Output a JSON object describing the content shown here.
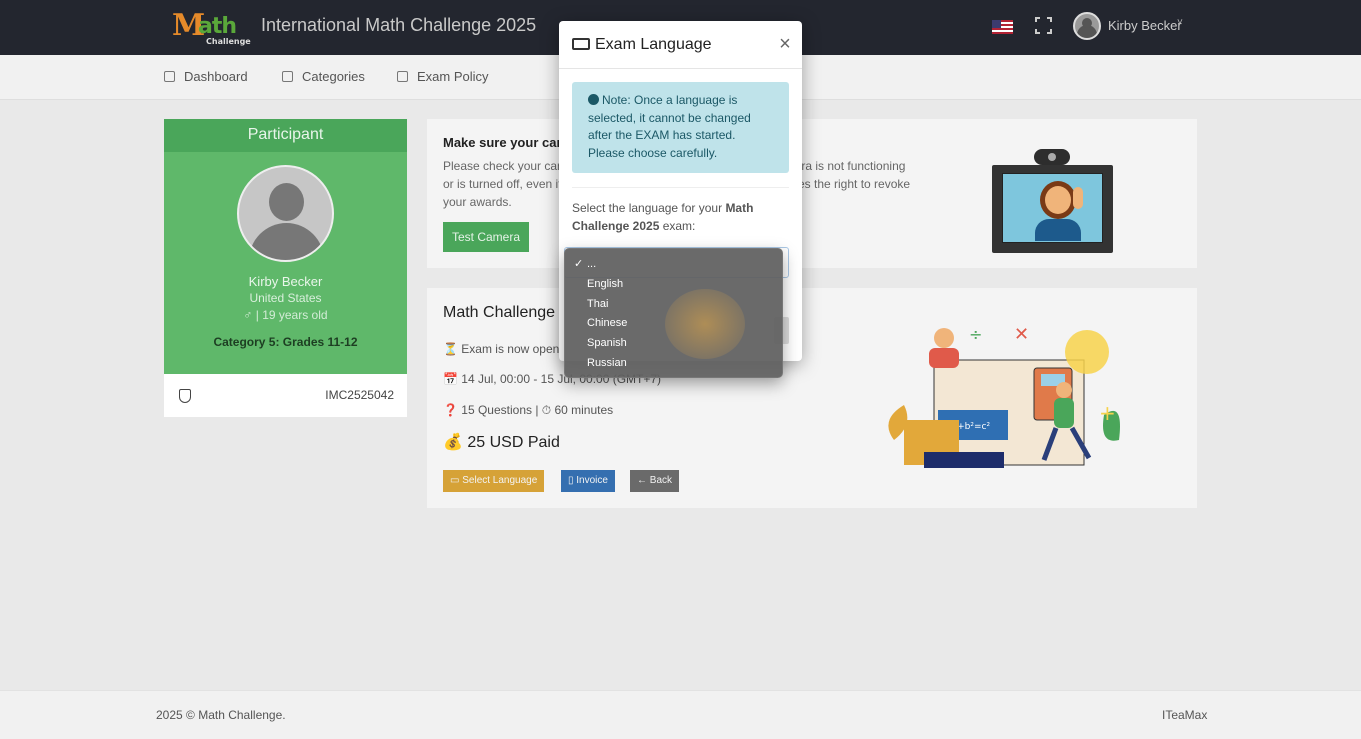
{
  "header": {
    "logo_text": "Math Challenge",
    "title": "International Math Challenge 2025",
    "language_flag_icon": "us-flag-icon",
    "fullscreen_icon": "fullscreen-icon",
    "user_name": "Kirby Becker",
    "user_caret": "˅"
  },
  "nav": {
    "items": [
      {
        "label": "Dashboard",
        "icon": "dashboard-icon"
      },
      {
        "label": "Categories",
        "icon": "categories-icon"
      },
      {
        "label": "Exam Policy",
        "icon": "document-icon"
      }
    ]
  },
  "participant": {
    "header": "Participant",
    "name": "Kirby Becker",
    "country": "United States",
    "age": "♂ | 19 years old",
    "category": "Category 5: Grades 11-12",
    "id": "IMC2525042"
  },
  "camera_card": {
    "title": "Make sure your cam",
    "text": "Please check your cam                                                 nera is not functioning or is turned off, even if                                            ves the right to revoke your awards.",
    "text_line1_start": "Please check your cam",
    "text_line1_end": "nera is not functioning",
    "text_line2_start": "or is turned off, even if",
    "text_line2_end": "ves the right to revoke",
    "text_line3": "your awards.",
    "button": "Test Camera"
  },
  "exam_card": {
    "title": "Math Challenge 2",
    "status": "⏳ Exam is now open",
    "dates": "📅 14 Jul, 00:00 - 15 Jul, 00:00 (GMT+7)",
    "questions": "❓ 15 Questions | ⏱ 60 minutes",
    "paid": "💰 25 USD Paid",
    "buttons": {
      "select_language": "Select Language",
      "invoice": "Invoice",
      "back": "← Back"
    }
  },
  "modal": {
    "title": "Exam Language",
    "close": "×",
    "note": "Note: Once a language is selected, it cannot be changed after the EXAM has started. Please choose carefully.",
    "select_label_prefix": "Select the language for your ",
    "select_label_bold": "Math Challenge 2025",
    "select_label_suffix": " exam:",
    "selected_value": "...",
    "options": [
      "...",
      "English",
      "Thai",
      "Chinese",
      "Spanish",
      "Russian"
    ],
    "check_mark": "✓"
  },
  "footer": {
    "copyright": "2025 © Math Challenge.",
    "credit": "ITeaMax"
  },
  "colors": {
    "header_bg": "#23262f",
    "participant_green": "#5fb86a",
    "button_green": "#4aa65a",
    "button_orange": "#d6a237",
    "button_blue": "#356fb0",
    "button_gray": "#6a6a6a",
    "alert_bg": "#bfe3ea",
    "dropdown_bg": "#5f5f5f"
  }
}
